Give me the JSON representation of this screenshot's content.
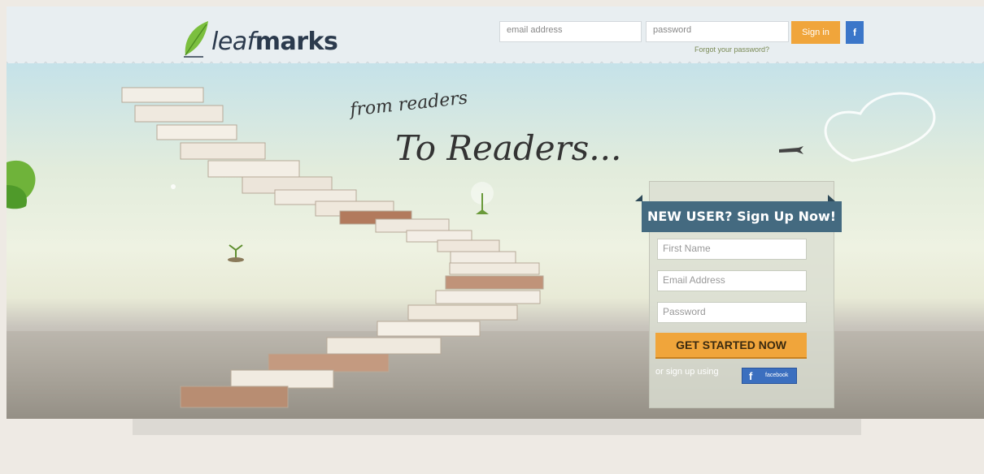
{
  "header": {
    "logo_text_light": "leaf",
    "logo_text_bold": "marks",
    "email_placeholder": "email address",
    "password_placeholder": "password",
    "signin_label": "Sign in",
    "facebook_mini_label": "f",
    "forgot_password": "Forgot your password?"
  },
  "hero": {
    "tagline_small": "from readers",
    "tagline_big": "To Readers..."
  },
  "signup": {
    "title": "NEW USER? Sign Up Now!",
    "first_name_placeholder": "First Name",
    "email_placeholder": "Email Address",
    "password_placeholder": "Password",
    "cta_label": "GET STARTED NOW",
    "alt_text": "or sign up using",
    "facebook_icon": "f",
    "facebook_label": "facebook"
  },
  "colors": {
    "accent_orange": "#f0a53b",
    "ribbon_blue": "#446a80",
    "facebook_blue": "#3b6fbf"
  }
}
